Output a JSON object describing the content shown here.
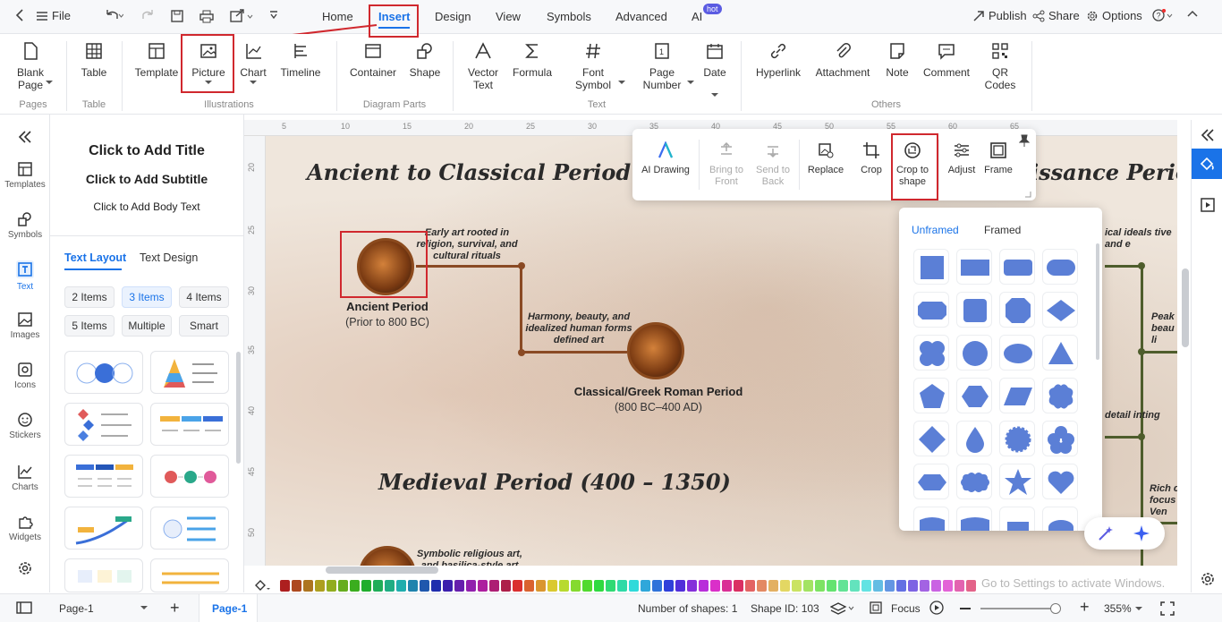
{
  "titlebar": {
    "file": "File",
    "tabs": [
      "Home",
      "Insert",
      "Design",
      "View",
      "Symbols",
      "Advanced",
      "AI"
    ],
    "active_tab": "Insert",
    "hot": "hot",
    "publish": "Publish",
    "share": "Share",
    "options": "Options"
  },
  "ribbon": {
    "blank_page": "Blank Page",
    "table": "Table",
    "template": "Template",
    "picture": "Picture",
    "chart": "Chart",
    "timeline": "Timeline",
    "container": "Container",
    "shape": "Shape",
    "vector_text": "Vector Text",
    "formula": "Formula",
    "font_symbol": "Font Symbol",
    "page_number": "Page Number",
    "date": "Date",
    "hyperlink": "Hyperlink",
    "attachment": "Attachment",
    "note": "Note",
    "comment": "Comment",
    "qr_codes": "QR Codes",
    "groups": {
      "pages": "Pages",
      "table": "Table",
      "illustrations": "Illustrations",
      "diagram_parts": "Diagram Parts",
      "text": "Text",
      "others": "Others"
    }
  },
  "leftrail": {
    "templates": "Templates",
    "symbols": "Symbols",
    "text": "Text",
    "images": "Images",
    "icons": "Icons",
    "stickers": "Stickers",
    "charts": "Charts",
    "widgets": "Widgets"
  },
  "leftpanel": {
    "title": "Click to Add Title",
    "subtitle": "Click to Add Subtitle",
    "body": "Click to Add Body Text",
    "tab_layout": "Text Layout",
    "tab_design": "Text Design",
    "chips": [
      "2 Items",
      "3 Items",
      "4 Items",
      "5 Items",
      "Multiple",
      "Smart"
    ],
    "active_chip": "3 Items"
  },
  "ruler": {
    "top": [
      "5",
      "10",
      "15",
      "20",
      "25",
      "30",
      "35",
      "40",
      "45",
      "50",
      "55",
      "60",
      "65"
    ],
    "left": [
      "20",
      "25",
      "30",
      "35",
      "40",
      "45",
      "50"
    ]
  },
  "canvas": {
    "heading1": "Ancient to Classical Period (800 BC",
    "heading1_right": "issance Period (",
    "heading2": "Medieval Period (400 – 1350)",
    "note_ancient": "Early art rooted in religion, survival, and cultural rituals",
    "ancient_name": "Ancient Period",
    "ancient_range": "(Prior to 800 BC)",
    "note_classical": "Harmony, beauty, and idealized human forms defined art",
    "classical_name": "Classical/Greek Roman Period",
    "classical_range": "(800 BC–400 AD)",
    "note_medieval": "Symbolic religious art, and basilica-style art",
    "right_notes": [
      "ical ideals tive and e",
      "Peak beau li",
      "detail inting",
      "Rich c focus Ven"
    ]
  },
  "floatbar": {
    "ai_drawing": "AI Drawing",
    "bring_to_front": "Bring to Front",
    "send_to_back": "Send to Back",
    "replace": "Replace",
    "crop": "Crop",
    "crop_to_shape": "Crop to shape",
    "adjust": "Adjust",
    "frame": "Frame"
  },
  "shapepanel": {
    "tab_unframed": "Unframed",
    "tab_framed": "Framed",
    "shape_color": "#5b7fd6"
  },
  "statusbar": {
    "page_select": "Page-1",
    "page_tab": "Page-1",
    "num_shapes": "Number of shapes: 1",
    "shape_id": "Shape ID: 103",
    "focus": "Focus",
    "zoom": "355%",
    "watermark": "Go to Settings to activate Windows."
  },
  "colors": {
    "accent": "#1a73e8",
    "highlight": "#d0282e",
    "timeline": "#8a4a24"
  }
}
